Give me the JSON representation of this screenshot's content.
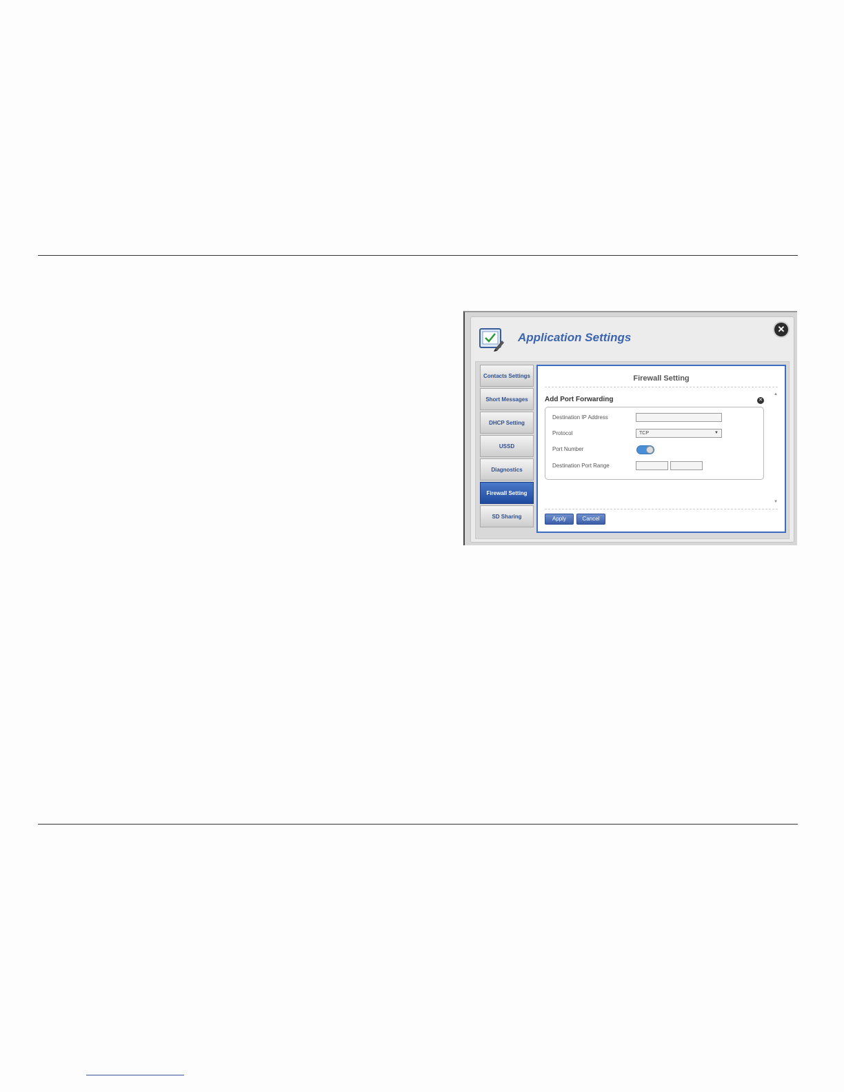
{
  "window": {
    "title": "Application Settings",
    "close_icon": "close-icon"
  },
  "sidebar": {
    "items": [
      {
        "label": "Contacts Settings",
        "active": false
      },
      {
        "label": "Short Messages",
        "active": false
      },
      {
        "label": "DHCP Setting",
        "active": false
      },
      {
        "label": "USSD",
        "active": false
      },
      {
        "label": "Diagnostics",
        "active": false
      },
      {
        "label": "Firewall Setting",
        "active": true
      },
      {
        "label": "SD Sharing",
        "active": false
      }
    ]
  },
  "content": {
    "title": "Firewall Setting",
    "section_title": "Add Port Forwarding",
    "form": {
      "dest_ip_label": "Destination IP Address",
      "dest_ip_value": "",
      "protocol_label": "Protocol",
      "protocol_value": "TCP",
      "port_number_label": "Port Number",
      "port_number_toggle": "on",
      "dest_port_range_label": "Destination Port Range",
      "port_range_start": "",
      "port_range_end": ""
    },
    "apply_label": "Apply",
    "cancel_label": "Cancel"
  },
  "colors": {
    "accent": "#3a6cc4",
    "active_tab": "#1f4b9e",
    "title_text": "#3c64ad"
  }
}
